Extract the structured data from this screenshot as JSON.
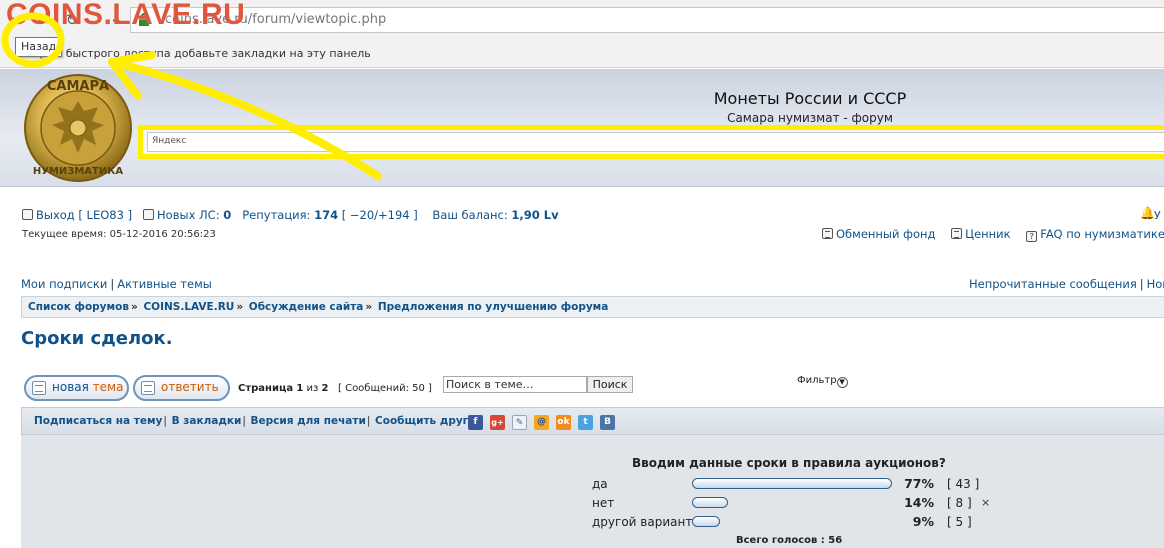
{
  "browser": {
    "url": "coins.lave.ru/forum/viewtopic.php",
    "bookmarks_hint": "Для быстрого доступа добавьте закладки на эту панель",
    "back_tooltip": "Назад"
  },
  "watermark": "COINS.LAVE.RU",
  "site": {
    "title": "Монеты России и СССР",
    "subtitle": "Самара нумизмат - форум",
    "search_placeholder": "Яндекс"
  },
  "user": {
    "logout": "Выход [ LEO83 ]",
    "new_pm_label": "Новых ЛС:",
    "new_pm_count": "0",
    "reputation_label": "Репутация:",
    "reputation_value": "174",
    "reputation_detail": "[ −20/+194 ]",
    "balance_label": "Ваш баланс:",
    "balance_value": "1,90 Lv",
    "current_time": "Текущее время: 05-12-2016 20:56:23",
    "notifications_truncated": "У"
  },
  "quick_links": {
    "exchange": "Обменный фонд",
    "price": "Ценник",
    "faq": "FAQ по нумизматике"
  },
  "sub_nav": {
    "subscriptions": "Мои подписки",
    "active_topics": "Активные темы",
    "unread": "Непрочитанные сообщения",
    "new_truncated": "Нов"
  },
  "breadcrumbs": [
    "Список форумов",
    "COINS.LAVE.RU",
    "Обсуждение сайта",
    "Предложения по улучшению форума"
  ],
  "topic": {
    "title": "Сроки сделок.",
    "new_topic_a": "новая",
    "new_topic_b": "тема",
    "reply": "ответить",
    "page_label": "Страница",
    "page_current": "1",
    "page_of": "из",
    "page_total": "2",
    "posts_info": "[ Сообщений: 50 ]",
    "search_placeholder": "Поиск в теме…",
    "search_button": "Поиск",
    "filter": "Фильтр"
  },
  "topic_tools": {
    "subscribe": "Подписаться на тему",
    "bookmark": "В закладки",
    "print": "Версия для печати",
    "tell_friend": "Сообщить другу"
  },
  "share_icons": [
    "facebook-icon",
    "google-plus-icon",
    "livejournal-icon",
    "mail-ru-icon",
    "odnoklassniki-icon",
    "twitter-icon",
    "vkontakte-icon"
  ],
  "poll": {
    "question": "Вводим данные сроки в правила аукционов?",
    "options": [
      {
        "label": "да",
        "percent": 77,
        "percent_text": "77%",
        "count_text": "[ 43 ]"
      },
      {
        "label": "нет",
        "percent": 14,
        "percent_text": "14%",
        "count_text": "[ 8 ]"
      },
      {
        "label": "другой вариант",
        "percent": 9,
        "percent_text": "9%",
        "count_text": "[ 5 ]"
      }
    ],
    "total": "Всего голосов : 56",
    "my_vote_mark": "×"
  },
  "colors": {
    "link": "#105289",
    "annotation": "#ffee00",
    "watermark": "#e0563e"
  }
}
